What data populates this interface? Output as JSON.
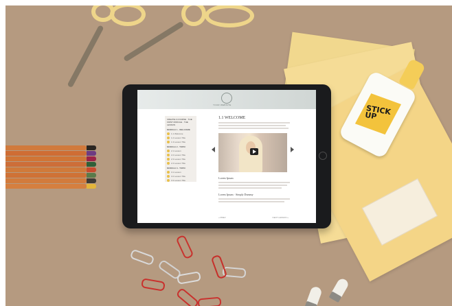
{
  "site": {
    "title": "YOUR WEBSITE"
  },
  "sidebar": {
    "course_title": "CREATE A COURSE · THE FIRST MODULE · THE LESSON",
    "sections": [
      {
        "label": "MODULE 1 · WELCOME",
        "items": [
          "1.1 Welcome",
          "1.2 Lesson Title",
          "1.3 Lesson Title"
        ]
      },
      {
        "label": "MODULE 2 · TOPIC",
        "items": [
          "2.1 Lesson",
          "2.2 Lesson Title",
          "2.3 Lesson Title",
          "2.4 Lesson Title"
        ]
      },
      {
        "label": "MODULE 3 · TOPIC",
        "items": [
          "3.1 Lesson",
          "3.2 Lesson Title",
          "3.3 Lesson Title"
        ]
      }
    ]
  },
  "lesson": {
    "title": "1.1 WELCOME",
    "section1": "Lorem Ipsum",
    "section2": "Lorem Ipsum · Simply Dummy"
  },
  "footer_nav": {
    "prev": "« PREV",
    "next": "NEXT LESSON »"
  },
  "glue": {
    "brand": "STICK UP"
  },
  "colors": {
    "desk": "#b59a80",
    "accent": "#e8c04a"
  }
}
